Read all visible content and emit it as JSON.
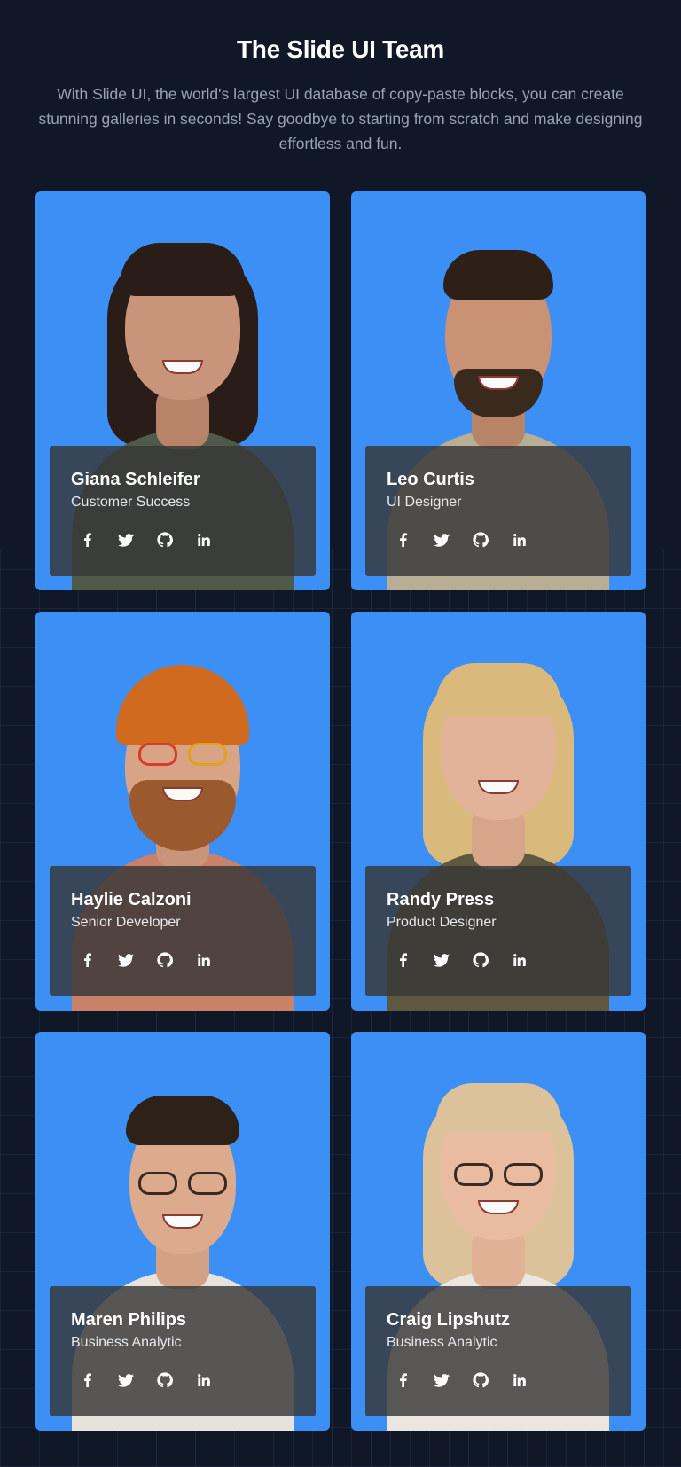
{
  "header": {
    "title": "The Slide UI Team",
    "subtitle": "With Slide UI, the world's largest UI database of copy-paste blocks, you can create stunning galleries in seconds! Say goodbye to starting from scratch and make designing effortless and fun."
  },
  "colors": {
    "background": "#101828",
    "card": "#3b8ff5",
    "overlay": "#373737"
  },
  "social_icons": [
    "facebook-icon",
    "twitter-icon",
    "github-icon",
    "linkedin-icon"
  ],
  "team": [
    {
      "name": "Giana Schleifer",
      "role": "Customer Success"
    },
    {
      "name": "Leo Curtis",
      "role": "UI Designer"
    },
    {
      "name": "Haylie Calzoni",
      "role": "Senior Developer"
    },
    {
      "name": "Randy Press",
      "role": "Product Designer"
    },
    {
      "name": "Maren Philips",
      "role": "Business Analytic"
    },
    {
      "name": "Craig Lipshutz",
      "role": "Business Analytic"
    }
  ]
}
